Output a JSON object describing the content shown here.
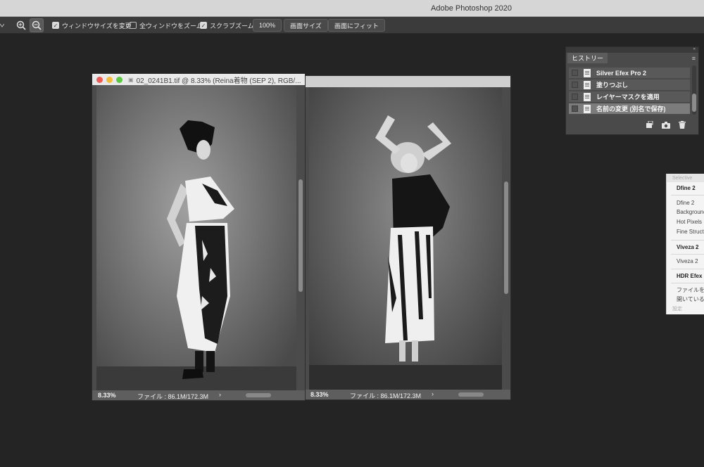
{
  "app": {
    "title": "Adobe Photoshop 2020"
  },
  "options_bar": {
    "zoom_in_icon": "zoom-in-icon",
    "zoom_out_icon": "zoom-out-icon",
    "resize_windows": {
      "label": "ウィンドウサイズを変更",
      "checked": true
    },
    "zoom_all_windows": {
      "label": "全ウィンドウをズーム",
      "checked": false
    },
    "scrubby_zoom": {
      "label": "スクラブズーム",
      "checked": true
    },
    "btn_100": "100%",
    "btn_fit_screen": "画面サイズ",
    "btn_fill_screen": "画面にフィット"
  },
  "documents": [
    {
      "title": "02_0241B1.tif @ 8.33% (Reina着物 (SEP 2), RGB/...",
      "zoom": "8.33%",
      "file_info": "ファイル : 86.1M/172.3M",
      "active": true
    },
    {
      "title": "",
      "zoom": "8.33%",
      "file_info": "ファイル : 86.1M/172.3M",
      "active": false
    }
  ],
  "history_panel": {
    "tab": "ヒストリー",
    "items": [
      {
        "label": "Silver Efex Pro 2",
        "selected": false
      },
      {
        "label": "塗りつぶし",
        "selected": false
      },
      {
        "label": "レイヤーマスクを適用",
        "selected": false
      },
      {
        "label": "名前の変更 (別名で保存)",
        "selected": true
      }
    ],
    "footer_icons": [
      "new-document-from-state-icon",
      "snapshot-camera-icon",
      "trash-icon"
    ]
  },
  "nik_panel": {
    "title": "Selective",
    "sections": [
      {
        "heading": "Dfine 2",
        "items": [
          "Dfine 2",
          "Background",
          "Hot Pixels",
          "Fine Struct"
        ]
      },
      {
        "heading": "Viveza 2",
        "items": [
          "Viveza 2"
        ]
      },
      {
        "heading": "HDR Efex",
        "items": [
          "ファイルを",
          "開いている"
        ]
      }
    ],
    "footer": "設定"
  }
}
